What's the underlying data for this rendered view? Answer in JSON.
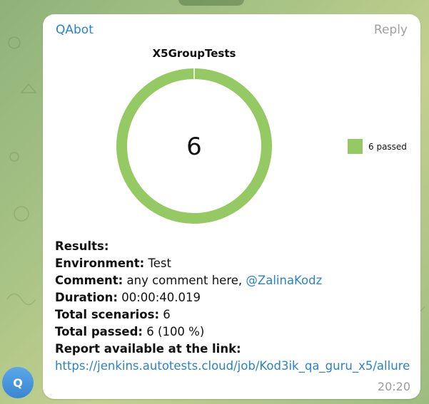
{
  "message": {
    "sender": "QAbot",
    "reply_label": "Reply",
    "time": "20:20",
    "avatar_letter": "Q"
  },
  "chart_data": {
    "type": "pie",
    "title": "X5GroupTests",
    "center_label": "6",
    "slices": [
      {
        "name": "6 passed",
        "value": 6,
        "color": "#95c964"
      }
    ],
    "legend": "right"
  },
  "results": {
    "heading": "Results:",
    "environment_label": "Environment:",
    "environment_value": " Test",
    "comment_label": "Comment:",
    "comment_value": " any comment here, ",
    "comment_mention": "@ZalinaKodz",
    "duration_label": "Duration:",
    "duration_value": " 00:00:40.019",
    "total_scenarios_label": "Total scenarios:",
    "total_scenarios_value": " 6",
    "total_passed_label": "Total passed:",
    "total_passed_value": " 6 (100 %)",
    "report_label": "Report available at the link:",
    "report_link": "https://jenkins.autotests.cloud/job/Kod3ik_qa_guru_x5/allure"
  },
  "colors": {
    "accent": "#2a83c6",
    "passed": "#95c964"
  }
}
